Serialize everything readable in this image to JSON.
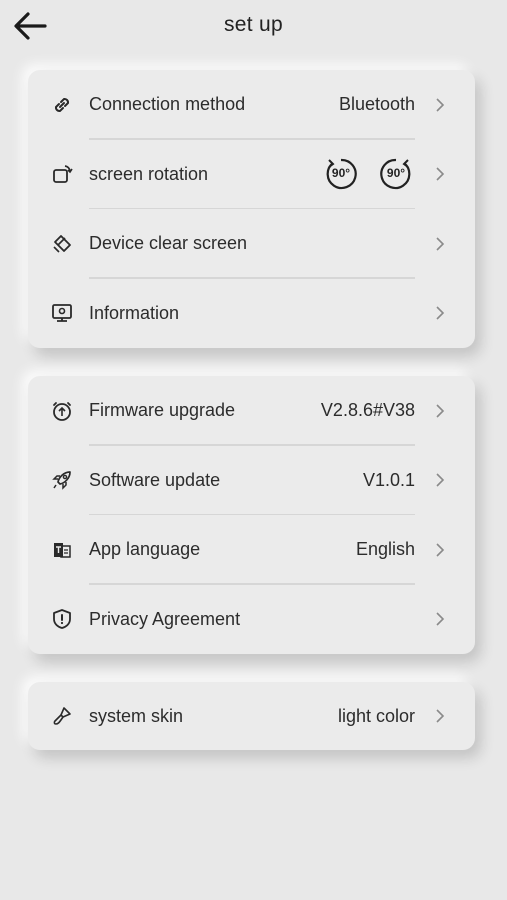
{
  "header": {
    "title": "set up"
  },
  "card1": {
    "rows": [
      {
        "label": "Connection method",
        "value": "Bluetooth",
        "icon": "link-icon"
      },
      {
        "label": "screen rotation",
        "value": "",
        "icon": "rotate-icon"
      },
      {
        "label": "Device clear screen",
        "value": "",
        "icon": "eraser-icon"
      },
      {
        "label": "Information",
        "value": "",
        "icon": "monitor-icon"
      }
    ],
    "rotation": {
      "left_label": "90°",
      "right_label": "90°"
    }
  },
  "card2": {
    "rows": [
      {
        "label": "Firmware upgrade",
        "value": "V2.8.6#V38",
        "icon": "firmware-icon"
      },
      {
        "label": "Software update",
        "value": "V1.0.1",
        "icon": "rocket-icon"
      },
      {
        "label": "App language",
        "value": "English",
        "icon": "language-icon"
      },
      {
        "label": "Privacy Agreement",
        "value": "",
        "icon": "shield-icon"
      }
    ]
  },
  "card3": {
    "rows": [
      {
        "label": "system skin",
        "value": "light color",
        "icon": "brush-icon"
      }
    ]
  },
  "colors": {
    "background": "#e8e8e8",
    "card": "#ebebeb",
    "text": "#2c2c2c",
    "chevron": "#8a8a8a",
    "divider": "#d6d6d6"
  }
}
